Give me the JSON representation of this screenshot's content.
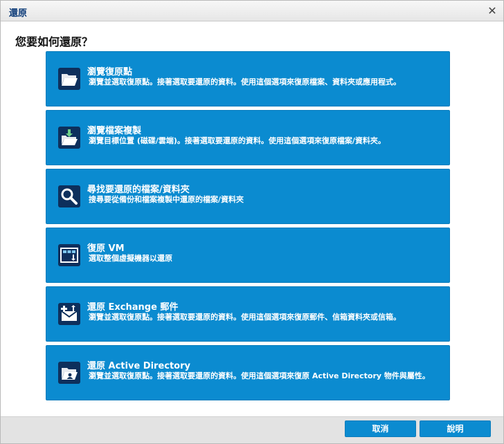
{
  "dialog": {
    "title": "還原",
    "question": "您要如何還原？"
  },
  "options": [
    {
      "label": "瀏覽復原點",
      "description": "瀏覽並選取復原點。接著選取要還原的資料。使用這個選項來復原檔案、資料夾或應用程式。",
      "icon": "folder-open-icon"
    },
    {
      "label": "瀏覽檔案複製",
      "description": "瀏覽目標位置 (磁碟/雲端)。接著選取要還原的資料。使用這個選項來復原檔案/資料夾。",
      "icon": "folder-download-icon"
    },
    {
      "label": "尋找要還原的檔案/資料夾",
      "description": "搜尋要從備份和檔案複製中還原的檔案/資料夾",
      "icon": "search-icon"
    },
    {
      "label": "復原 VM",
      "description": "選取整個虛擬機器以還原",
      "icon": "vm-icon"
    },
    {
      "label": "還原 Exchange 郵件",
      "description": "瀏覽並選取復原點。接著選取要還原的資料。使用這個選項來復原郵件、信箱資料夾或信箱。",
      "icon": "exchange-mail-icon"
    },
    {
      "label": "還原 Active Directory",
      "description": "瀏覽並選取復原點。接著選取要還原的資料。使用這個選項來復原 Active Directory 物件與屬性。",
      "icon": "active-directory-icon"
    }
  ],
  "footer": {
    "cancel_label": "取消",
    "help_label": "說明"
  },
  "colors": {
    "option_bg": "#0b8bd0",
    "icon_bg": "#0d2f5c",
    "title_text": "#0b3a78"
  }
}
